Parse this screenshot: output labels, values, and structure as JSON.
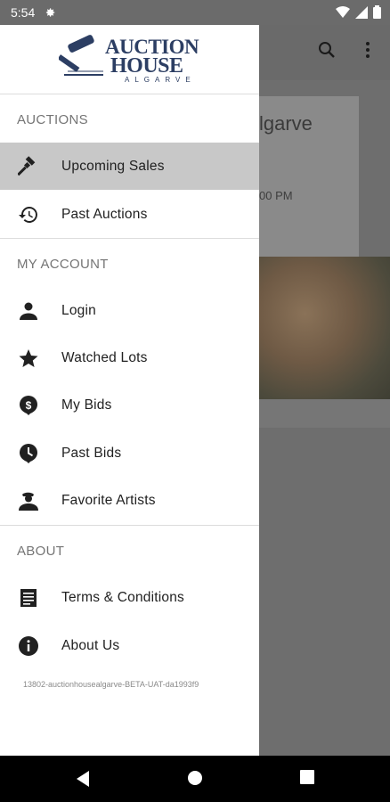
{
  "status_bar": {
    "time": "5:54"
  },
  "background": {
    "title_partial": "lgarve",
    "time_partial": "00 PM"
  },
  "logo": {
    "line1": "AUCTION",
    "line2": "HOUSE",
    "line3": "ALGARVE"
  },
  "sections": {
    "auctions": "AUCTIONS",
    "account": "MY ACCOUNT",
    "about": "ABOUT"
  },
  "menu": {
    "upcoming_sales": "Upcoming Sales",
    "past_auctions": "Past Auctions",
    "login": "Login",
    "watched_lots": "Watched Lots",
    "my_bids": "My Bids",
    "past_bids": "Past Bids",
    "favorite_artists": "Favorite Artists",
    "terms": "Terms & Conditions",
    "about_us": "About Us"
  },
  "version": "13802-auctionhousealgarve-BETA-UAT-da1993f9",
  "icons": {
    "upcoming_sales": "gavel-icon",
    "past_auctions": "history-icon",
    "login": "person-icon",
    "watched_lots": "star-icon",
    "my_bids": "dollar-pin-icon",
    "past_bids": "clock-pin-icon",
    "favorite_artists": "artist-icon",
    "terms": "document-icon",
    "about_us": "info-icon"
  },
  "colors": {
    "brand": "#2c3e63",
    "active_bg": "#c8c8c8"
  }
}
